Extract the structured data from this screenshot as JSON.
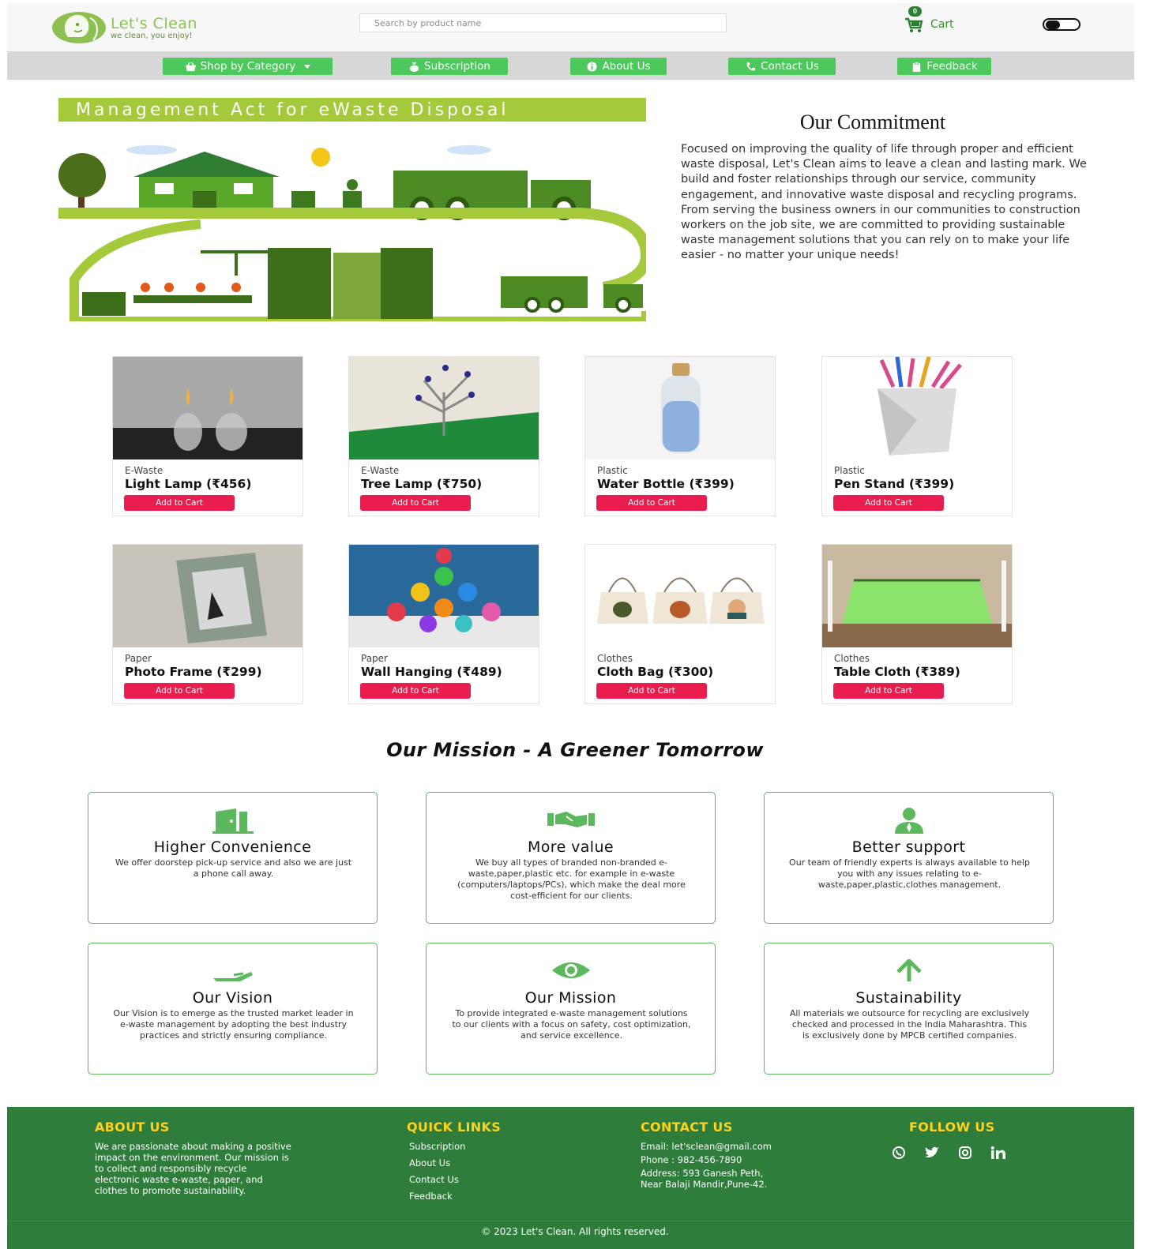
{
  "brand": {
    "name": "Let's Clean",
    "tagline": "we clean, you enjoy!",
    "accent": "#8cc152"
  },
  "search": {
    "placeholder": "Search by product name"
  },
  "cart": {
    "count": "0",
    "label": "Cart"
  },
  "nav": {
    "shop": "Shop by Category",
    "subscription": "Subscription",
    "about": "About Us",
    "contact": "Contact Us",
    "feedback": "Feedback",
    "color": "#4cc95a"
  },
  "hero": {
    "banner": "Management Act for eWaste Disposal",
    "commitment_title": "Our Commitment",
    "commitment_text": "Focused on improving the quality of life through proper and efficient waste disposal, Let's Clean aims to leave a clean and lasting mark. We build and foster relationships through our service, community engagement, and innovative waste disposal and recycling programs. From serving the business owners in our communities to construction workers on the job site, we are committed to providing sustainable waste management solutions that you can rely on to make your life easier - no matter your unique needs!"
  },
  "products": [
    {
      "category": "E-Waste",
      "name": "Light Lamp (₹456)",
      "button": "Add to Cart"
    },
    {
      "category": "E-Waste",
      "name": "Tree Lamp (₹750)",
      "button": "Add to Cart"
    },
    {
      "category": "Plastic",
      "name": "Water Bottle (₹399)",
      "button": "Add to Cart"
    },
    {
      "category": "Plastic",
      "name": "Pen Stand (₹399)",
      "button": "Add to Cart"
    },
    {
      "category": "Paper",
      "name": "Photo Frame (₹299)",
      "button": "Add to Cart"
    },
    {
      "category": "Paper",
      "name": "Wall Hanging (₹489)",
      "button": "Add to Cart"
    },
    {
      "category": "Clothes",
      "name": "Cloth Bag (₹300)",
      "button": "Add to Cart"
    },
    {
      "category": "Clothes",
      "name": "Table Cloth (₹389)",
      "button": "Add to Cart"
    }
  ],
  "mission": {
    "title": "Our Mission - A Greener Tomorrow",
    "features": [
      {
        "icon": "door-icon",
        "title": "Higher Convenience",
        "text": "We offer doorstep pick-up service and also we are just a phone call away."
      },
      {
        "icon": "handshake-icon",
        "title": "More value",
        "text": "We buy all types of branded non-branded e-waste,paper,plastic etc. for example in e-waste (computers/laptops/PCs), which make the deal more cost-efficient for our clients."
      },
      {
        "icon": "user-tie-icon",
        "title": "Better support",
        "text": "Our team of friendly experts is always available to help you with any issues relating to e-waste,paper,plastic,clothes management."
      },
      {
        "icon": "hand-icon",
        "title": "Our Vision",
        "text": "Our Vision is to emerge as the trusted market leader in e-waste management by adopting the best industry practices and strictly ensuring compliance."
      },
      {
        "icon": "eye-icon",
        "title": "Our Mission",
        "text": "To provide integrated e-waste management solutions to our clients with a focus on safety, cost optimization, and service excellence."
      },
      {
        "icon": "arrow-up-icon",
        "title": "Sustainability",
        "text": "All materials we outsource for recycling are exclusively checked and processed in the India Maharashtra. This is exclusively done by MPCB certified companies."
      }
    ]
  },
  "footer": {
    "about_title": "ABOUT US",
    "about_text": "We are passionate about making a positive impact on the environment. Our mission is to collect and responsibly recycle electronic waste e-waste, paper, and clothes to promote sustainability.",
    "links_title": "QUICK LINKS",
    "links": [
      "Subscription",
      "About Us",
      "Contact Us",
      "Feedback"
    ],
    "contact_title": "CONTACT US",
    "email": "Email: let'sclean@gmail.com",
    "phone": "Phone : 982-456-7890",
    "address_1": "Address: 593 Ganesh Peth,",
    "address_2": "Near Balaji Mandir,Pune-42.",
    "follow_title": "FOLLOW US",
    "social": [
      "whatsapp-icon",
      "twitter-icon",
      "instagram-icon",
      "linkedin-icon"
    ],
    "copyright": "© 2023 Let's Clean. All rights reserved.",
    "bg": "#2e7d3a",
    "heading_color": "#ffd21f"
  }
}
